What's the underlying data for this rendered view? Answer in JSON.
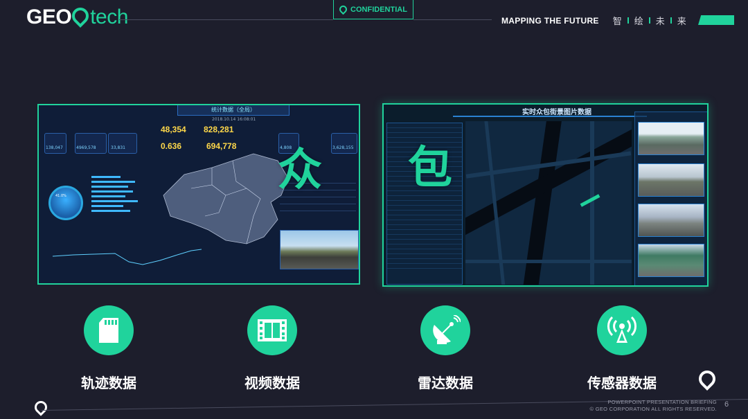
{
  "header": {
    "logo_geo": "GEO",
    "logo_tech": "tech",
    "confidential": "CONFIDENTIAL",
    "tagline_en": "MAPPING THE FUTURE",
    "tagline_zh": [
      "智",
      "绘",
      "未",
      "来"
    ]
  },
  "panels": {
    "left": {
      "title": "统计数据（全局）",
      "date": "2018.10.14 16:08:01",
      "overlay_char": "众",
      "stats": {
        "num1": "48,354",
        "num2": "828,281",
        "num3": "0.636",
        "num4": "694,778",
        "small1": "138,047",
        "small2": "4969,578",
        "small3": "33,831",
        "small4": "4,808",
        "small5": "3,628,155"
      },
      "gauge": "41.0%"
    },
    "right": {
      "title": "实时众包街景图片数据",
      "overlay_char": "包"
    }
  },
  "features": [
    {
      "label": "轨迹数据",
      "icon": "sd-card-icon"
    },
    {
      "label": "视频数据",
      "icon": "film-strip-icon"
    },
    {
      "label": "雷达数据",
      "icon": "radar-dish-icon"
    },
    {
      "label": "传感器数据",
      "icon": "signal-tower-icon"
    }
  ],
  "footer": {
    "line1": "POWERPOINT PRESENTATION BRIEFING",
    "line2": "© GEO CORPORATION ALL RIGHTS RESERVED.",
    "page": "6"
  },
  "colors": {
    "accent": "#20d39c",
    "background": "#1d1e2c",
    "text": "#ffffff"
  }
}
